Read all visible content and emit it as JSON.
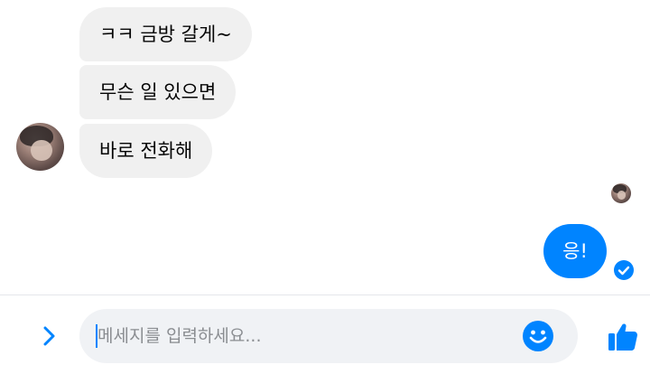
{
  "messages": {
    "incoming": [
      {
        "text": "ㅋㅋ 금방 갈게~"
      },
      {
        "text": "무슨 일 있으면"
      },
      {
        "text": "바로 전화해"
      }
    ],
    "outgoing": [
      {
        "text": "응!",
        "status": "sent-check-icon"
      }
    ]
  },
  "composer": {
    "placeholder": "메세지를 입력하세요...",
    "value": ""
  },
  "icons": {
    "expand": "chevron-right-icon",
    "emoji": "smiley-icon",
    "like": "thumbs-up-icon",
    "seen": "avatar",
    "sent": "check-circle-icon"
  },
  "colors": {
    "accent": "#0084ff",
    "incoming_bubble": "#f0f0f0",
    "composer_bg": "#f0f2f5"
  }
}
